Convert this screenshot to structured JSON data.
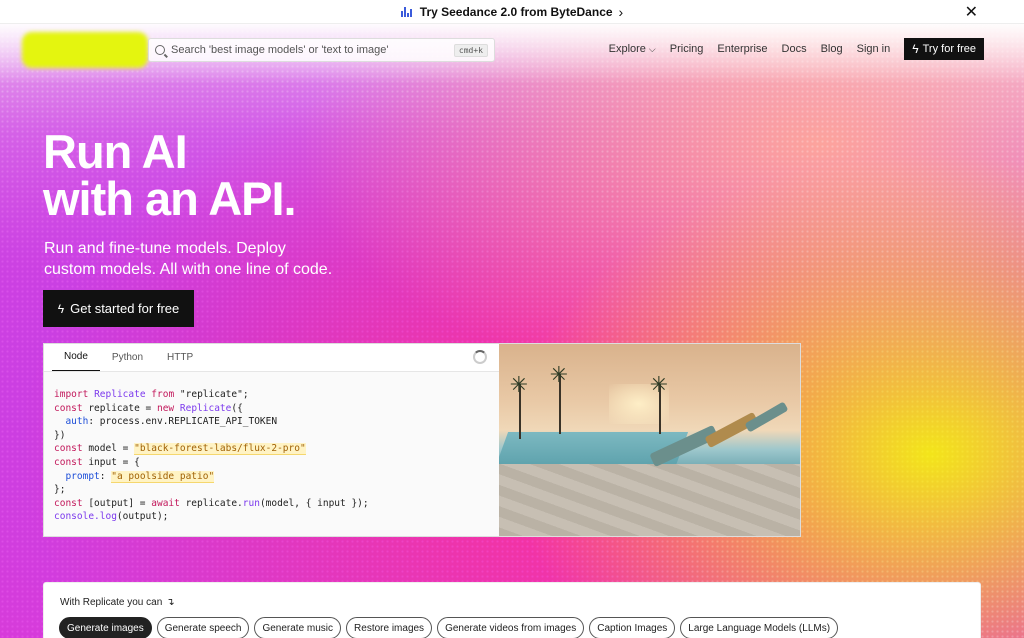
{
  "announcement": {
    "text": "Try Seedance 2.0 from ByteDance",
    "chevron": "›",
    "close": "✕"
  },
  "nav": {
    "search_placeholder": "Search 'best image models' or 'text to image'",
    "search_shortcut": "cmd+k",
    "explore": "Explore",
    "pricing": "Pricing",
    "enterprise": "Enterprise",
    "docs": "Docs",
    "blog": "Blog",
    "sign_in": "Sign in",
    "try_free": "Try for free"
  },
  "hero": {
    "headline_line1": "Run AI",
    "headline_line2": "with an API.",
    "subhead_line1": "Run and fine-tune models. Deploy",
    "subhead_line2": "custom models. All with one line of code.",
    "cta": "Get started for free"
  },
  "code_card": {
    "tabs": [
      {
        "label": "Node",
        "active": true
      },
      {
        "label": "Python",
        "active": false
      },
      {
        "label": "HTTP",
        "active": false
      }
    ],
    "code": {
      "l1_import": "import",
      "l1_name": "Replicate",
      "l1_from": "from",
      "l1_mod": "\"replicate\"",
      "l1_end": ";",
      "l2_const": "const",
      "l2_var": " replicate = ",
      "l2_new": "new",
      "l2_cls": "Replicate",
      "l2_end": "({",
      "l3_prop": "auth",
      "l3_val": ": process.env.REPLICATE_API_TOKEN",
      "l4": "})",
      "l5_const": "const",
      "l5_var": " model = ",
      "l5_str": "\"black-forest-labs/flux-2-pro\"",
      "l6_const": "const",
      "l6_var": " input = {",
      "l7_prop": "prompt",
      "l7_colon": ": ",
      "l7_str": "\"a poolside patio\"",
      "l8": "};",
      "l9_const": "const",
      "l9_var": " [output] = ",
      "l9_await": "await",
      "l9_call": " replicate.",
      "l9_fn": "run",
      "l9_args": "(model, { input });",
      "l10_fn": "console.log",
      "l10_args": "(output);"
    }
  },
  "capabilities": {
    "label": "With Replicate you can",
    "arrow": "↴",
    "chips": [
      {
        "label": "Generate images",
        "active": true
      },
      {
        "label": "Generate speech",
        "active": false
      },
      {
        "label": "Generate music",
        "active": false
      },
      {
        "label": "Restore images",
        "active": false
      },
      {
        "label": "Generate videos from images",
        "active": false
      },
      {
        "label": "Caption Images",
        "active": false
      },
      {
        "label": "Large Language Models (LLMs)",
        "active": false
      }
    ]
  },
  "icons": {
    "bolt": "ϟ",
    "chevron_down": "⌵"
  }
}
